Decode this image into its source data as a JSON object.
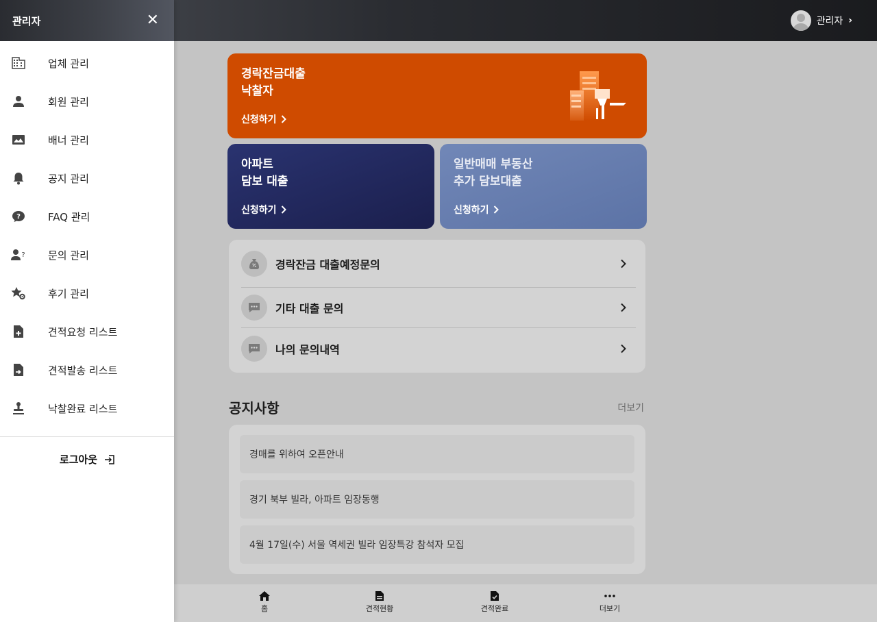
{
  "header": {
    "user_name": "관리자",
    "user_chevron": "›"
  },
  "banners": [
    {
      "title": "경락잔금대출\n낙찰자",
      "apply": "신청하기"
    },
    {
      "title": "아파트\n담보 대출",
      "apply": "신청하기"
    },
    {
      "title": "일반매매 부동산\n추가 담보대출",
      "apply": "신청하기"
    }
  ],
  "inquiries": [
    {
      "label": "경락잔금 대출예정문의",
      "icon": "money-bag-icon"
    },
    {
      "label": "기타 대출 문의",
      "icon": "chat-icon"
    },
    {
      "label": "나의 문의내역",
      "icon": "chat-icon"
    }
  ],
  "notice": {
    "title": "공지사항",
    "more": "더보기",
    "items": [
      "경매를 위하여 오픈안내",
      "경기 북부 빌라, 아파트 임장동행",
      "4월 17일(수) 서울 역세권 빌라 임장특강 참석자 모집"
    ]
  },
  "bottom_nav": [
    {
      "label": "홈",
      "icon": "home-icon"
    },
    {
      "label": "견적현황",
      "icon": "document-icon"
    },
    {
      "label": "견적완료",
      "icon": "document-check-icon"
    },
    {
      "label": "더보기",
      "icon": "more-icon"
    }
  ],
  "sidebar": {
    "title": "관리자",
    "close": "✕",
    "items": [
      {
        "label": "업체 관리",
        "icon": "building-icon"
      },
      {
        "label": "회원 관리",
        "icon": "person-icon"
      },
      {
        "label": "배너 관리",
        "icon": "image-icon"
      },
      {
        "label": "공지 관리",
        "icon": "bell-icon"
      },
      {
        "label": "FAQ 관리",
        "icon": "faq-bubble-icon"
      },
      {
        "label": "문의 관리",
        "icon": "person-question-icon"
      },
      {
        "label": "후기 관리",
        "icon": "star-gear-icon"
      },
      {
        "label": "견적요청 리스트",
        "icon": "file-plus-icon"
      },
      {
        "label": "견적발송 리스트",
        "icon": "file-send-icon"
      },
      {
        "label": "낙찰완료 리스트",
        "icon": "stamp-icon"
      }
    ],
    "logout": "로그아웃"
  },
  "colors": {
    "orange_banner": "#cf4b00",
    "navy_banner": "#1b1f4d",
    "blue_banner": "#5c73a6",
    "header_dark": "#1a1b1e"
  }
}
